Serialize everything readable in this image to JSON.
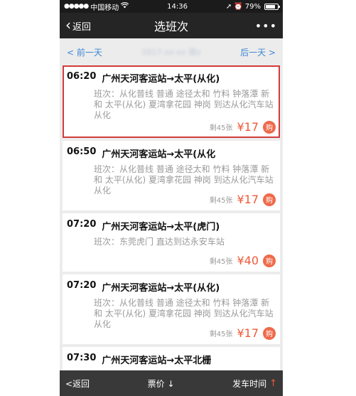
{
  "status": {
    "carrier": "中国移动",
    "time": "14:36",
    "battery": "79%",
    "battery_level": 0.79
  },
  "nav": {
    "back": "返回",
    "title": "选班次",
    "more": "•••"
  },
  "daybar": {
    "prev": "< 前一天",
    "date": "2017-xx-xx 周x",
    "next": "后一天 >"
  },
  "trips": [
    {
      "time": "06:20",
      "title": "广州天河客运站→太平(从化)",
      "route": "班次：从化普线 普通 途径太和 竹料 钟落潭 新和 太平(从化) 夏湾拿花园 神岗 到达从化汽车站 从化",
      "seats": "剩45张",
      "price": "¥17",
      "buy": "购"
    },
    {
      "time": "06:50",
      "title": "广州天河客运站→太平(从化",
      "route": "班次：从化普线 普通 途径太和 竹料 钟落潭 新和 太平(从化) 夏湾拿花园 神岗 到达从化汽车站 从化",
      "seats": "剩45张",
      "price": "¥17",
      "buy": "购"
    },
    {
      "time": "07:20",
      "title": "广州天河客运站→太平(虎门)",
      "route": "班次：东莞虎门 直达到达永安车站",
      "seats": "剩45张",
      "price": "¥40",
      "buy": "购"
    },
    {
      "time": "07:20",
      "title": "广州天河客运站→太平(从化)",
      "route": "班次：从化普线 普通 途径太和 竹料 钟落潭 新和 太平(从化) 夏湾拿花园 神岗 到达从化汽车站 从化",
      "seats": "剩45张",
      "price": "¥17",
      "buy": "购"
    },
    {
      "time": "07:30",
      "title": "广州天河客运站→太平北栅",
      "route": "",
      "seats": "",
      "price": "",
      "buy": ""
    }
  ],
  "bottombar": {
    "back": "<返回",
    "price_sort": "票价 ↓",
    "time_sort": "发车时间",
    "time_arrow": "↑"
  }
}
